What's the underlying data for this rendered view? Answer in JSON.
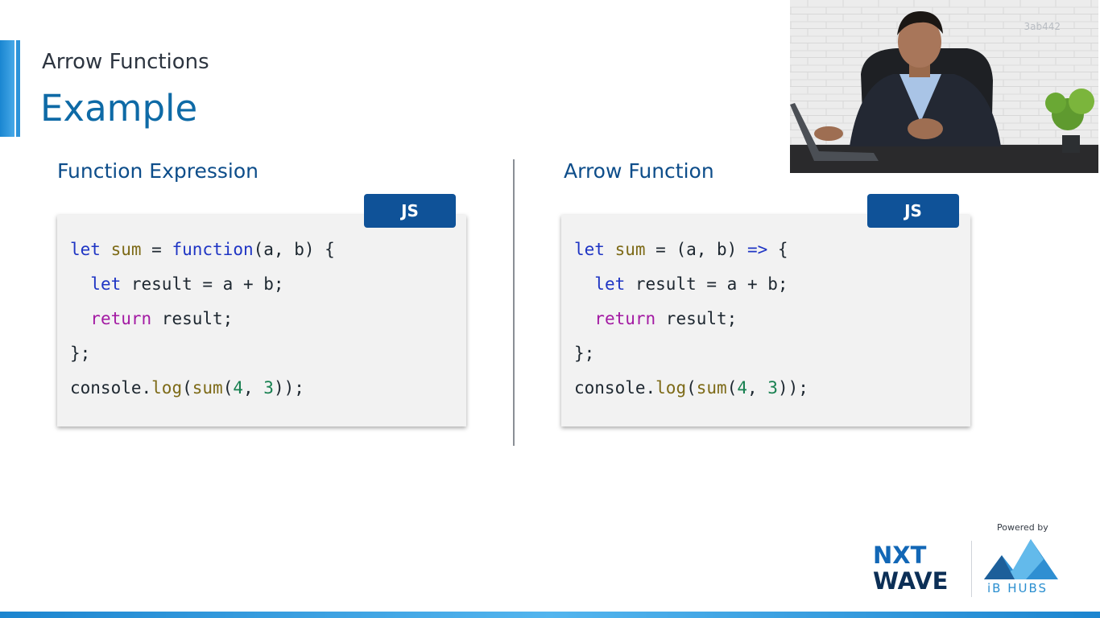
{
  "slide": {
    "subtitle": "Arrow Functions",
    "title": "Example"
  },
  "left": {
    "heading": "Function Expression",
    "badge": "JS",
    "code_lines": [
      [
        {
          "t": "let",
          "c": "kw"
        },
        {
          "t": " "
        },
        {
          "t": "sum",
          "c": "fnname"
        },
        {
          "t": " = "
        },
        {
          "t": "function",
          "c": "kw"
        },
        {
          "t": "(a, b) {"
        }
      ],
      [
        {
          "t": "  "
        },
        {
          "t": "let",
          "c": "kw"
        },
        {
          "t": " result = a + b;"
        }
      ],
      [
        {
          "t": "  "
        },
        {
          "t": "return",
          "c": "ret"
        },
        {
          "t": " result;"
        }
      ],
      [
        {
          "t": "};"
        }
      ],
      [
        {
          "t": "console."
        },
        {
          "t": "log",
          "c": "fnname"
        },
        {
          "t": "("
        },
        {
          "t": "sum",
          "c": "fnname"
        },
        {
          "t": "("
        },
        {
          "t": "4",
          "c": "num"
        },
        {
          "t": ", "
        },
        {
          "t": "3",
          "c": "num"
        },
        {
          "t": "));"
        }
      ]
    ]
  },
  "right": {
    "heading": "Arrow Function",
    "badge": "JS",
    "code_lines": [
      [
        {
          "t": "let",
          "c": "kw"
        },
        {
          "t": " "
        },
        {
          "t": "sum",
          "c": "fnname"
        },
        {
          "t": " = (a, b) "
        },
        {
          "t": "=>",
          "c": "kw"
        },
        {
          "t": " {"
        }
      ],
      [
        {
          "t": "  "
        },
        {
          "t": "let",
          "c": "kw"
        },
        {
          "t": " result = a + b;"
        }
      ],
      [
        {
          "t": "  "
        },
        {
          "t": "return",
          "c": "ret"
        },
        {
          "t": " result;"
        }
      ],
      [
        {
          "t": "};"
        }
      ],
      [
        {
          "t": "console."
        },
        {
          "t": "log",
          "c": "fnname"
        },
        {
          "t": "("
        },
        {
          "t": "sum",
          "c": "fnname"
        },
        {
          "t": "("
        },
        {
          "t": "4",
          "c": "num"
        },
        {
          "t": ", "
        },
        {
          "t": "3",
          "c": "num"
        },
        {
          "t": "));"
        }
      ]
    ]
  },
  "video": {
    "id_label": "3ab442"
  },
  "branding": {
    "nxtwave_line1": "NXT",
    "nxtwave_line2": "WAVE",
    "powered_by": "Powered by",
    "ib_hubs": "iB HUBS"
  },
  "colors": {
    "title": "#0e6aa6",
    "heading": "#0d4d8a",
    "badge": "#0f5298",
    "keyword": "#1f35c4",
    "identifier": "#7d6a17",
    "return_kw": "#a31aa3",
    "number": "#178050",
    "accent": "#1a86d1"
  }
}
